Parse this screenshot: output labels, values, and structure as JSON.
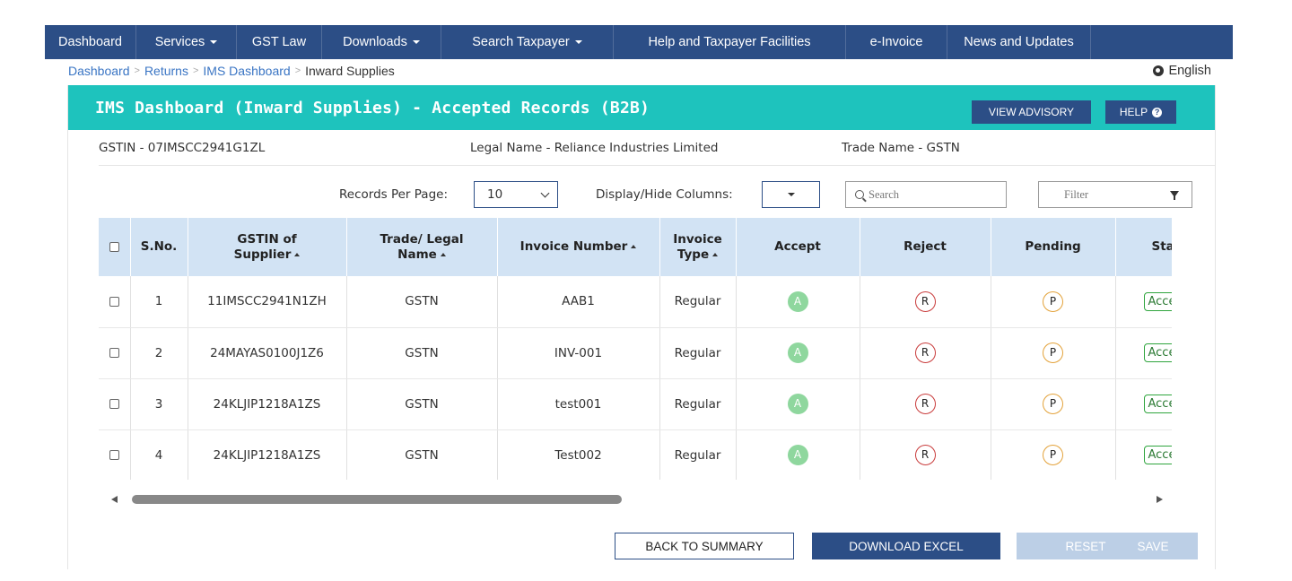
{
  "nav": {
    "items": [
      {
        "label": "Dashboard",
        "dropdown": false
      },
      {
        "label": "Services",
        "dropdown": true
      },
      {
        "label": "GST Law",
        "dropdown": false
      },
      {
        "label": "Downloads",
        "dropdown": true
      },
      {
        "label": "Search Taxpayer",
        "dropdown": true
      },
      {
        "label": "Help and Taxpayer Facilities",
        "dropdown": false
      },
      {
        "label": "e-Invoice",
        "dropdown": false
      },
      {
        "label": "News and Updates",
        "dropdown": false
      }
    ]
  },
  "breadcrumb": {
    "items": [
      "Dashboard",
      "Returns",
      "IMS Dashboard"
    ],
    "current": "Inward Supplies"
  },
  "language": "English",
  "panel": {
    "title": "IMS Dashboard (Inward Supplies) - Accepted Records (B2B)",
    "view_advisory": "VIEW ADVISORY",
    "help": "HELP",
    "help_icon": "?"
  },
  "info": {
    "gstin": "GSTIN - 07IMSCC2941G1ZL",
    "legal_name": "Legal Name - Reliance Industries Limited",
    "trade_name": "Trade Name - GSTN"
  },
  "controls": {
    "records_per_page_label": "Records Per Page:",
    "records_per_page_value": "10",
    "display_hide_label": "Display/Hide Columns:",
    "search_placeholder": "Search",
    "filter_label": "Filter"
  },
  "table": {
    "headers": {
      "sno": "S.No.",
      "gstin_1": "GSTIN of",
      "gstin_2": "Supplier",
      "trade_1": "Trade/ Legal",
      "trade_2": "Name",
      "invoice_number": "Invoice Number",
      "invoice_type_1": "Invoice",
      "invoice_type_2": "Type",
      "accept": "Accept",
      "reject": "Reject",
      "pending": "Pending",
      "status": "Status"
    },
    "action_letters": {
      "accept": "A",
      "reject": "R",
      "pending": "P"
    },
    "rows": [
      {
        "sno": "1",
        "gstin": "11IMSCC2941N1ZH",
        "trade": "GSTN",
        "invoice": "AAB1",
        "type": "Regular",
        "status": "Accepted"
      },
      {
        "sno": "2",
        "gstin": "24MAYAS0100J1Z6",
        "trade": "GSTN",
        "invoice": "INV-001",
        "type": "Regular",
        "status": "Accepted"
      },
      {
        "sno": "3",
        "gstin": "24KLJIP1218A1ZS",
        "trade": "GSTN",
        "invoice": "test001",
        "type": "Regular",
        "status": "Accepted"
      },
      {
        "sno": "4",
        "gstin": "24KLJIP1218A1ZS",
        "trade": "GSTN",
        "invoice": "Test002",
        "type": "Regular",
        "status": "Accepted"
      }
    ]
  },
  "buttons": {
    "back": "BACK TO SUMMARY",
    "download": "DOWNLOAD EXCEL",
    "reset": "RESET",
    "save": "SAVE"
  },
  "colors": {
    "nav_bg": "#2c4e86",
    "panel_header": "#1ec3bd",
    "table_header": "#d2e3f4",
    "accept": "#8fd79e",
    "reject": "#c93c3c",
    "pending": "#e3a23a",
    "status_accepted": "#2fa53e"
  }
}
